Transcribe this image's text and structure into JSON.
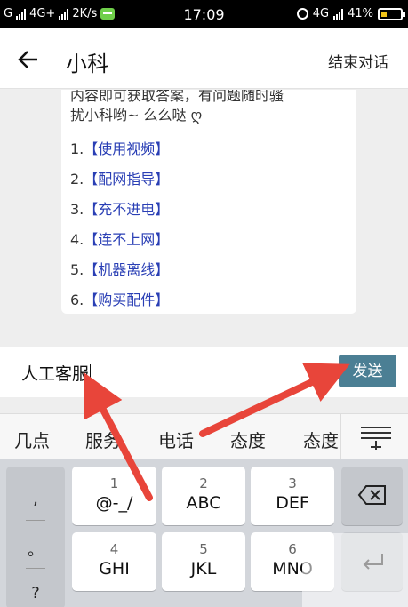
{
  "status_bar": {
    "carrier1": "G",
    "carrier2": "4G+",
    "speed": "2K/s",
    "time": "17:09",
    "network": "4G",
    "battery": "41%"
  },
  "header": {
    "title": "小科",
    "end_label": "结束对话"
  },
  "chat": {
    "cut_line": "内容即可获取答案，有问题随时骚",
    "line2": "扰小科哟~ 么么哒 ღ",
    "faq_items": [
      {
        "num": "1.",
        "label": "【使用视频】"
      },
      {
        "num": "2.",
        "label": "【配网指导】"
      },
      {
        "num": "3.",
        "label": "【充不进电】"
      },
      {
        "num": "4.",
        "label": "【连不上网】"
      },
      {
        "num": "5.",
        "label": "【机器离线】"
      },
      {
        "num": "6.",
        "label": "【购买配件】"
      }
    ]
  },
  "input": {
    "value": "人工客服",
    "send_label": "发送"
  },
  "suggestions": [
    "几点",
    "服务",
    "电话",
    "态度",
    "态度"
  ],
  "keyboard": {
    "side": [
      ",",
      "。",
      "?"
    ],
    "keys": [
      {
        "num": "1",
        "label": "@-_/"
      },
      {
        "num": "2",
        "label": "ABC"
      },
      {
        "num": "3",
        "label": "DEF"
      },
      {
        "num": "4",
        "label": "GHI"
      },
      {
        "num": "5",
        "label": "JKL"
      },
      {
        "num": "6",
        "label": "MNO"
      }
    ]
  },
  "colors": {
    "accent": "#4b7f94",
    "link": "#2a3fb5",
    "arrow": "#e8453a"
  }
}
